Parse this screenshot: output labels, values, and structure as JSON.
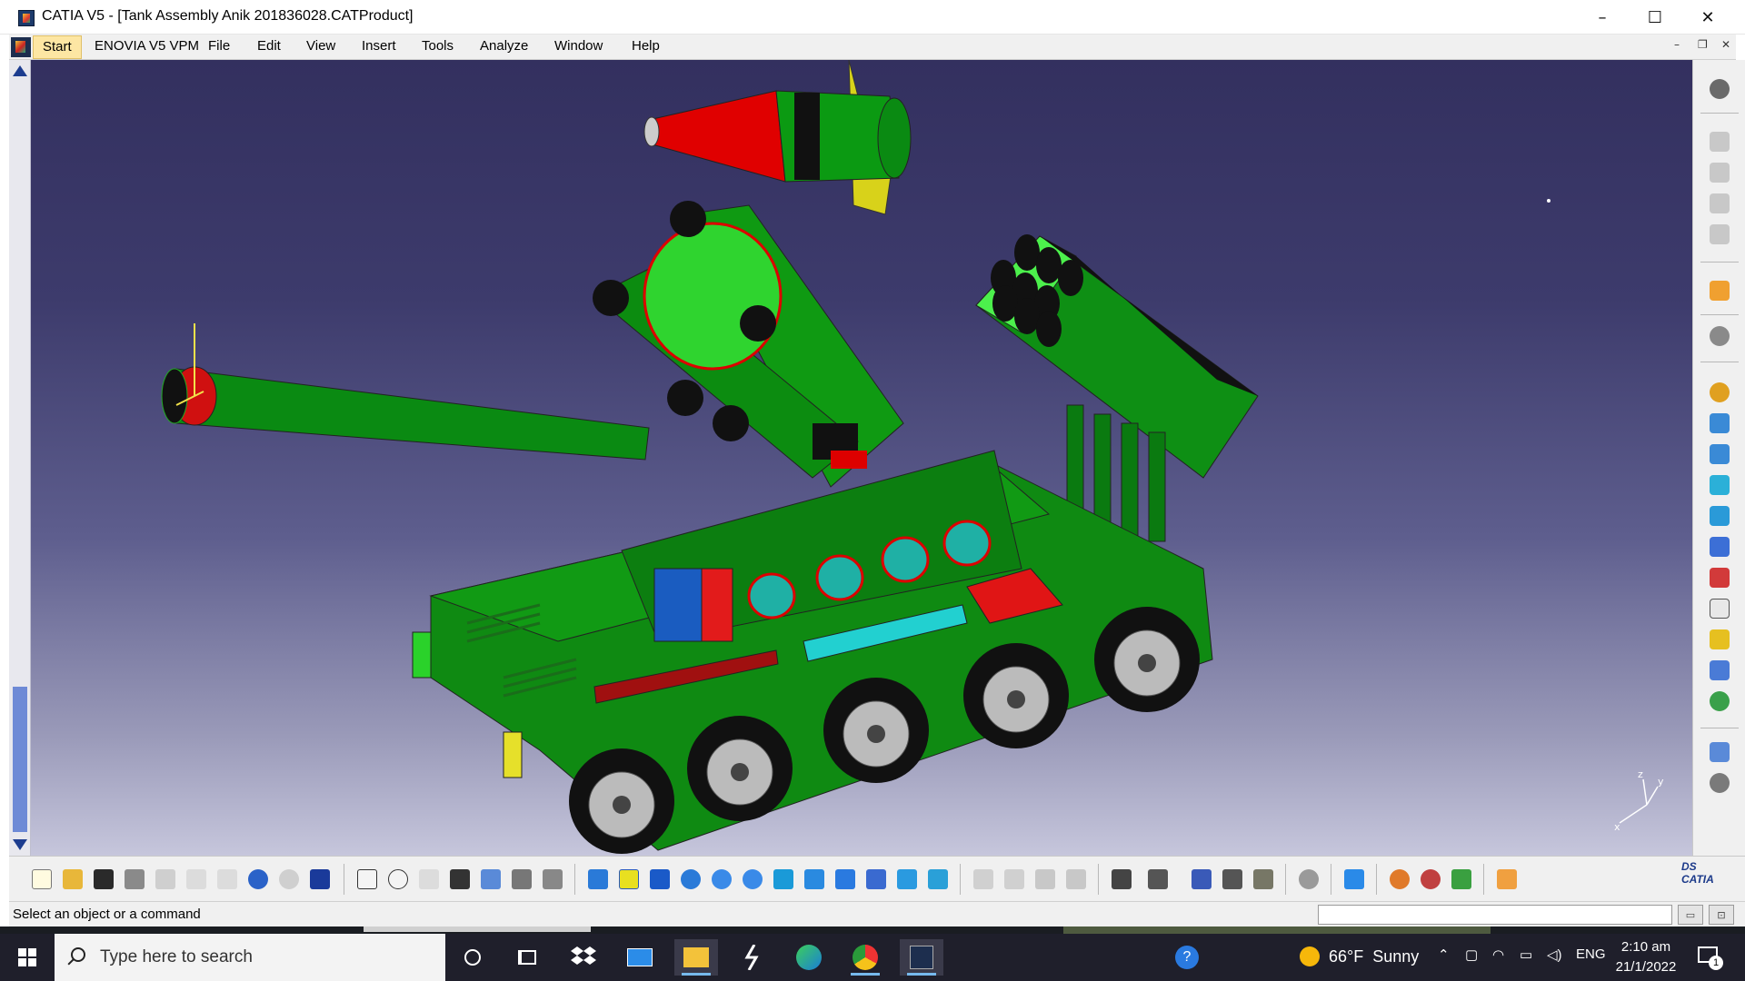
{
  "window": {
    "title": "CATIA V5 - [Tank Assembly Anik 201836028.CATProduct]",
    "controls": {
      "minimize": "–",
      "maximize": "☐",
      "close": "✕"
    }
  },
  "menu": {
    "start": "Start",
    "items": [
      "ENOVIA V5 VPM",
      "File",
      "Edit",
      "View",
      "Insert",
      "Tools",
      "Analyze",
      "Window",
      "Help"
    ]
  },
  "viewport": {
    "background_top": "#33305f",
    "background_bottom": "#c6c6dc",
    "compass_axes": {
      "x": "x",
      "y": "y",
      "z": "z"
    }
  },
  "right_toolbar": {
    "icons": [
      "compass-icon",
      "freeze-icon",
      "fix-icon",
      "fix-together-icon",
      "manipulation-icon",
      "select-icon",
      "snap-icon",
      "insert-product-icon",
      "insert-component-icon",
      "existing-component-icon",
      "replace-component-icon",
      "graph-tree-icon",
      "generate-numbering-icon",
      "bill-of-material-icon",
      "constraints-icon",
      "coincidence-icon",
      "contact-icon",
      "offset-icon",
      "angle-icon",
      "reuse-pattern-icon",
      "update-icon"
    ]
  },
  "bottom_toolbar": {
    "icons": [
      "new-icon",
      "open-icon",
      "save-icon",
      "print-icon",
      "cut-icon",
      "copy-icon",
      "paste-icon",
      "undo-icon",
      "redo-icon",
      "whats-this-icon",
      "formula-icon",
      "knowledge-icon",
      "measure-icon",
      "table-icon",
      "tree-icon",
      "catalog-icon",
      "macro-icon",
      "fly-icon",
      "fit-all-icon",
      "pan-icon",
      "rotate-icon",
      "zoom-in-icon",
      "zoom-out-icon",
      "normal-view-icon",
      "multi-view-icon",
      "iso-view-icon",
      "shading-icon",
      "hide-show-icon",
      "swap-visible-icon",
      "link-icon",
      "reorder-icon",
      "component-icon",
      "assembly-icon",
      "capture-icon",
      "scene-icon",
      "measure-between-icon",
      "measure-item-icon",
      "measure-inertia-icon",
      "update-all-icon",
      "cut-plane-icon",
      "render-icon",
      "apply-material-icon",
      "material-library-icon",
      "grid-icon"
    ],
    "brand": "CATIA",
    "brand_prefix": "DS"
  },
  "status": {
    "message": "Select an object or a command",
    "power_input_placeholder": ""
  },
  "taskbar": {
    "search_placeholder": "Type here to search",
    "apps": [
      "cortana-icon",
      "task-view-icon",
      "dropbox-icon",
      "mail-icon",
      "file-explorer-icon",
      "winamp-icon",
      "edge-icon",
      "chrome-icon",
      "catia-icon"
    ],
    "help_icon": "help-icon",
    "weather": {
      "temp": "66°F",
      "condition": "Sunny"
    },
    "tray": {
      "language": "ENG"
    },
    "clock": {
      "time": "2:10 am",
      "date": "21/1/2022"
    },
    "notification_count": "1"
  }
}
